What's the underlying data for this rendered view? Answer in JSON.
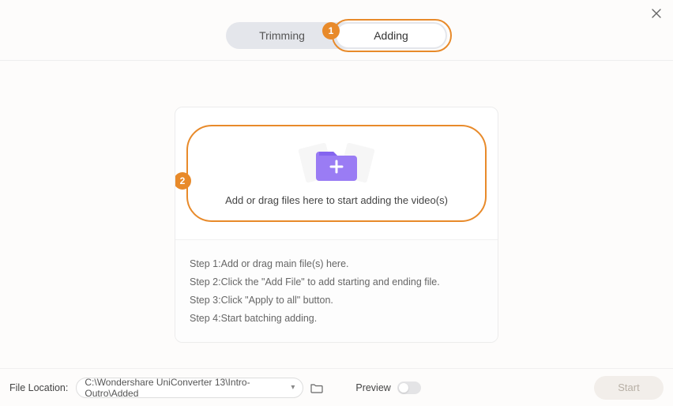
{
  "close_label": "Close",
  "tabs": {
    "trimming": "Trimming",
    "adding": "Adding"
  },
  "annotations": {
    "badge1": "1",
    "badge2": "2"
  },
  "dropzone": {
    "text": "Add or drag files here to start adding the video(s)"
  },
  "steps": {
    "s1": "Step 1:Add or drag main file(s) here.",
    "s2": "Step 2:Click the \"Add File\" to add starting and ending file.",
    "s3": "Step 3:Click \"Apply to all\" button.",
    "s4": "Step 4:Start batching adding."
  },
  "footer": {
    "file_location_label": "File Location:",
    "path": "C:\\Wondershare UniConverter 13\\Intro-Outro\\Added",
    "preview_label": "Preview",
    "start_label": "Start"
  }
}
